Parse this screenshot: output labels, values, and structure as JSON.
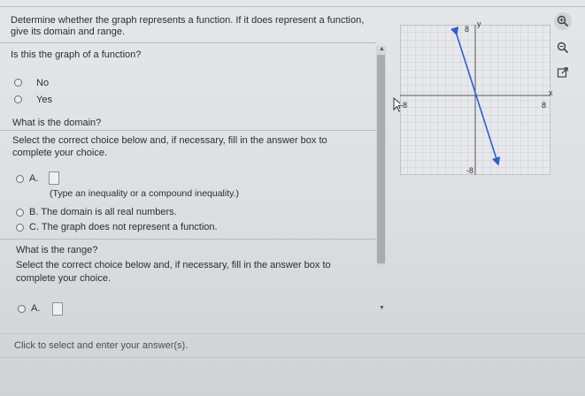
{
  "question": {
    "prompt_line1": "Determine whether the graph represents a function. If it does represent a function,",
    "prompt_line2": "give its domain and range.",
    "sub_question": "Is this the graph of a function?",
    "options": [
      {
        "label": "No"
      },
      {
        "label": "Yes"
      }
    ]
  },
  "domain_section": {
    "heading": "What is the domain?",
    "instruction_line1": "Select the correct choice below and, if necessary, fill in the answer box to",
    "instruction_line2": "complete your choice.",
    "choice_a_letter": "A.",
    "choice_a_hint": "(Type an inequality or a compound inequality.)",
    "choice_b": "B.  The domain is all real numbers.",
    "choice_c": "C.  The graph does not represent a function."
  },
  "range_section": {
    "heading": "What is the range?",
    "instruction_line1": "Select the correct choice below and, if necessary, fill in the answer box to",
    "instruction_line2": "complete your choice.",
    "choice_a_letter": "A."
  },
  "status": {
    "message": "Click to select and enter your answer(s)."
  },
  "graph": {
    "y_axis_label": "y",
    "x_axis_label": "x",
    "y_top_tick": "8",
    "y_bottom_tick": "-8",
    "x_left_tick": "-8",
    "x_right_tick": "8",
    "line_color": "#2d5fd0"
  },
  "icons": [
    "zoom-in-icon",
    "zoom-out-icon",
    "popout-icon"
  ]
}
